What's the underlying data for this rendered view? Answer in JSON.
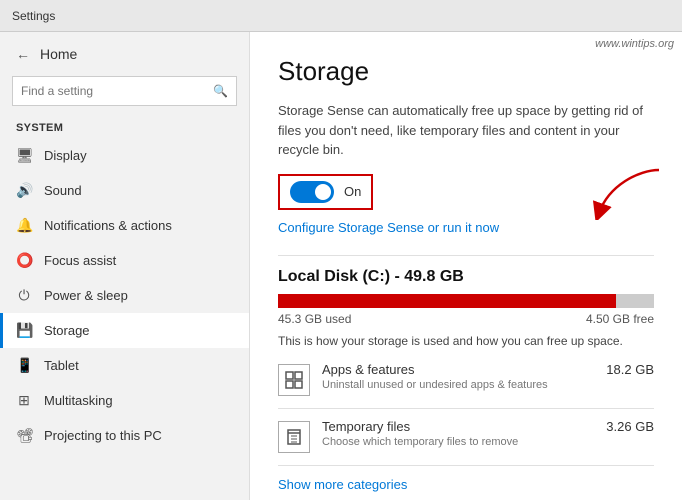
{
  "window": {
    "title": "Settings"
  },
  "sidebar": {
    "back_icon": "←",
    "header_title": "Home",
    "search_placeholder": "Find a setting",
    "section_label": "System",
    "items": [
      {
        "id": "display",
        "label": "Display",
        "icon": "🖥"
      },
      {
        "id": "sound",
        "label": "Sound",
        "icon": "🔊"
      },
      {
        "id": "notifications",
        "label": "Notifications & actions",
        "icon": "🔔"
      },
      {
        "id": "focus-assist",
        "label": "Focus assist",
        "icon": "⭕"
      },
      {
        "id": "power-sleep",
        "label": "Power & sleep",
        "icon": "⏻"
      },
      {
        "id": "storage",
        "label": "Storage",
        "icon": "💾",
        "active": true
      },
      {
        "id": "tablet",
        "label": "Tablet",
        "icon": "📱"
      },
      {
        "id": "multitasking",
        "label": "Multitasking",
        "icon": "⊞"
      },
      {
        "id": "projecting",
        "label": "Projecting to this PC",
        "icon": "📽"
      }
    ]
  },
  "main": {
    "title": "Storage",
    "description": "Storage Sense can automatically free up space by getting rid of files you don't need, like temporary files and content in your recycle bin.",
    "toggle_label": "On",
    "toggle_on": true,
    "configure_link": "Configure Storage Sense or run it now",
    "local_disk_heading": "Local Disk (C:) - 49.8 GB",
    "disk_used_label": "45.3 GB used",
    "disk_free_label": "4.50 GB free",
    "disk_used_pct": 90,
    "disk_help": "This is how your storage is used and how you can free up space.",
    "storage_items": [
      {
        "name": "Apps & features",
        "size": "18.2 GB",
        "desc": "Uninstall unused or undesired apps & features",
        "icon": "apps"
      },
      {
        "name": "Temporary files",
        "size": "3.26 GB",
        "desc": "Choose which temporary files to remove",
        "icon": "trash"
      }
    ],
    "show_more": "Show more categories",
    "watermark": "www.wintips.org"
  }
}
